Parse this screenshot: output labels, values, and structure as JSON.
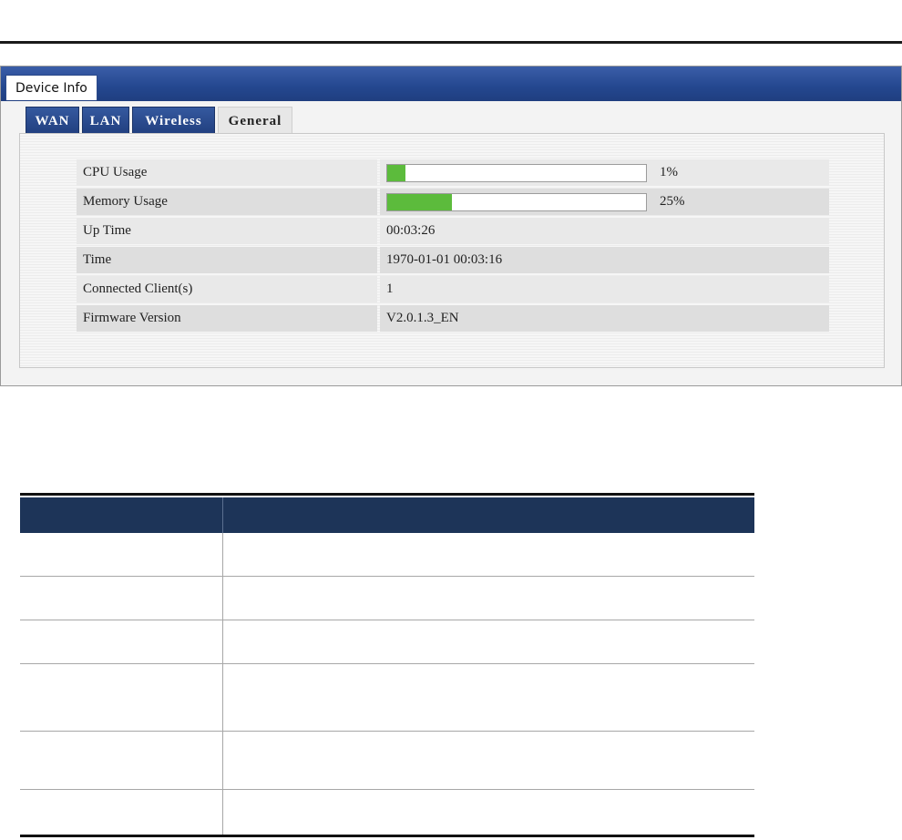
{
  "panel": {
    "main_tab": "Device Info",
    "subtabs": [
      {
        "label": "WAN",
        "active": false
      },
      {
        "label": "LAN",
        "active": false
      },
      {
        "label": "Wireless",
        "active": false
      },
      {
        "label": "General",
        "active": true
      }
    ]
  },
  "info": {
    "cpu": {
      "label": "CPU Usage",
      "percent_text": "1%",
      "level": 0.07
    },
    "memory": {
      "label": "Memory Usage",
      "percent_text": "25%",
      "level": 0.25
    },
    "uptime": {
      "label": "Up Time",
      "value": "00:03:26"
    },
    "time": {
      "label": "Time",
      "value": "1970-01-01 00:03:16"
    },
    "clients": {
      "label": "Connected Client(s)",
      "value": "1"
    },
    "firmware": {
      "label": "Firmware Version",
      "value": "V2.0.1.3_EN"
    }
  },
  "colors": {
    "header_blue": "#24478f",
    "usage_bar_green": "#5cbb3c",
    "table_header_navy": "#1d3458"
  }
}
